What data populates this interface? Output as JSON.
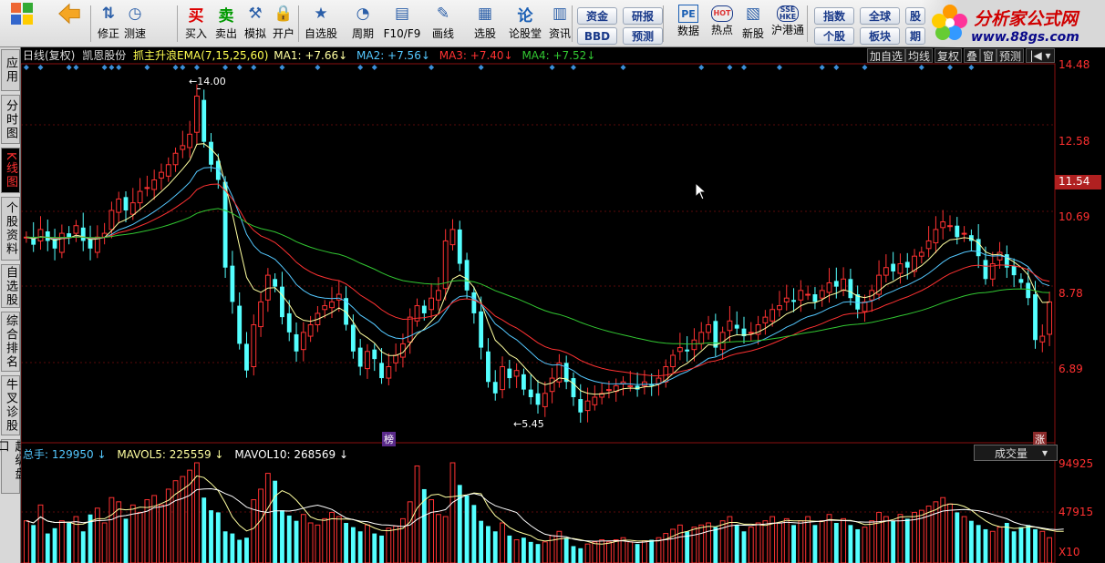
{
  "toolbar": {
    "buttons": [
      {
        "label": "修正",
        "icon": "up-down-arrow-icon"
      },
      {
        "label": "测速",
        "icon": "clock-icon"
      },
      {
        "label": "买入",
        "icon": "buy-icon",
        "glyph": "买"
      },
      {
        "label": "卖出",
        "icon": "sell-icon",
        "glyph": "卖"
      },
      {
        "label": "模拟",
        "icon": "hammer-icon"
      },
      {
        "label": "开户",
        "icon": "lock-icon"
      },
      {
        "label": "自选股",
        "icon": "star-list-icon"
      },
      {
        "label": "周期",
        "icon": "period-icon"
      },
      {
        "label": "F10/F9",
        "icon": "f10-icon"
      },
      {
        "label": "画线",
        "icon": "pen-icon"
      },
      {
        "label": "选股",
        "icon": "select-stock-icon"
      },
      {
        "label": "论股堂",
        "icon": "forum-icon",
        "glyph": "论"
      },
      {
        "label": "资讯",
        "icon": "news-icon"
      },
      {
        "label": "数据",
        "icon": "pe-icon",
        "glyph": "PE"
      },
      {
        "label": "热点",
        "icon": "hot-icon",
        "glyph": "HOT"
      },
      {
        "label": "新股",
        "icon": "new-stock-icon"
      },
      {
        "label": "沪港通",
        "icon": "sse-hke-icon",
        "glyph": "SSE HKE"
      }
    ],
    "pills": [
      "资金",
      "BBD",
      "研报",
      "预测",
      "指数",
      "个股",
      "全球",
      "板块",
      "股",
      "期"
    ],
    "logo_title": "分析家公式网",
    "logo_url": "www.88gs.com"
  },
  "left_tabs": [
    "应用",
    "分时图",
    "K线图",
    "个股资料",
    "自选股",
    "综合排名",
    "牛叉诊股",
    "超级盘口"
  ],
  "header": {
    "period": "日线(复权)",
    "stock": "凯恩股份",
    "indicator": "抓主升浪EMA(7,15,25,60)",
    "ma1": "MA1: +7.66",
    "ma2": "MA2: +7.56",
    "ma3": "MA3: +7.40",
    "ma4": "MA4: +7.52",
    "right_buttons": [
      "加自选",
      "均线",
      "复权",
      "叠",
      "窗",
      "预测"
    ]
  },
  "price_axis": [
    "14.48",
    "12.58",
    "11.54",
    "10.69",
    "8.78",
    "6.89"
  ],
  "volume_axis": [
    "94925",
    "47915",
    "X10"
  ],
  "annotations": {
    "high": "14.00",
    "low": "5.45",
    "bang": "榜",
    "zhang": "涨"
  },
  "volume_header": {
    "total": "总手: 129950",
    "mavol5": "MAVOL5: 225559",
    "mavol10": "MAVOL10: 268569",
    "selector": "成交量"
  },
  "colors": {
    "up": "#ff3232",
    "down": "#54ffff",
    "ma1": "#ffffa0",
    "ma2": "#54c8ff",
    "ma3": "#ff3232",
    "ma4": "#32c832",
    "marker": "#3b8fd9",
    "label_red": "#ff3030"
  },
  "chart_data": {
    "type": "candlestick",
    "y_range": [
      5.0,
      14.8
    ],
    "volume_range": [
      0,
      95000
    ],
    "close": [
      10.3,
      10.1,
      10.5,
      10.2,
      10.0,
      10.4,
      10.3,
      10.6,
      10.2,
      10.0,
      10.3,
      10.4,
      11.0,
      11.3,
      11.0,
      11.2,
      11.5,
      11.6,
      11.8,
      12.0,
      12.2,
      12.5,
      12.7,
      13.0,
      14.0,
      12.8,
      12.2,
      11.8,
      9.5,
      8.6,
      7.5,
      6.8,
      8.0,
      8.6,
      9.3,
      9.0,
      8.2,
      7.8,
      7.3,
      7.8,
      8.0,
      8.3,
      8.5,
      8.6,
      8.8,
      8.0,
      7.3,
      6.9,
      7.3,
      7.1,
      6.6,
      6.9,
      7.2,
      7.5,
      8.2,
      8.5,
      8.3,
      8.7,
      8.9,
      10.2,
      10.5,
      9.6,
      8.9,
      8.3,
      7.4,
      6.5,
      6.2,
      6.9,
      6.6,
      6.8,
      6.3,
      6.1,
      5.9,
      6.2,
      6.6,
      7.0,
      6.5,
      6.1,
      5.7,
      6.0,
      6.1,
      6.2,
      6.3,
      6.4,
      6.5,
      6.4,
      6.3,
      6.5,
      6.4,
      6.6,
      6.9,
      7.2,
      7.4,
      7.3,
      7.6,
      7.8,
      8.0,
      7.4,
      7.8,
      8.1,
      7.9,
      7.7,
      7.8,
      8.0,
      8.2,
      8.4,
      8.5,
      8.7,
      8.6,
      8.9,
      8.8,
      8.6,
      8.9,
      9.1,
      9.0,
      9.2,
      8.7,
      8.4,
      8.6,
      8.9,
      9.3,
      9.5,
      9.4,
      9.6,
      9.5,
      9.8,
      9.9,
      10.2,
      10.5,
      10.7,
      10.6,
      10.3,
      10.4,
      10.2,
      9.8,
      9.2,
      9.6,
      9.9,
      9.5,
      9.3,
      9.1,
      8.7,
      7.6,
      7.7,
      8.6
    ],
    "volume": [
      40,
      36,
      55,
      28,
      33,
      40,
      38,
      44,
      30,
      46,
      52,
      38,
      62,
      58,
      42,
      55,
      48,
      60,
      64,
      55,
      70,
      78,
      82,
      88,
      95,
      62,
      50,
      48,
      30,
      28,
      22,
      24,
      60,
      70,
      85,
      78,
      50,
      45,
      40,
      46,
      38,
      36,
      42,
      48,
      44,
      38,
      34,
      30,
      36,
      28,
      26,
      33,
      35,
      42,
      58,
      92,
      70,
      60,
      46,
      44,
      95,
      74,
      64,
      55,
      40,
      35,
      30,
      38,
      26,
      22,
      24,
      20,
      18,
      20,
      26,
      30,
      24,
      16,
      14,
      18,
      20,
      22,
      20,
      22,
      24,
      20,
      18,
      21,
      22,
      24,
      28,
      32,
      36,
      30,
      34,
      36,
      38,
      34,
      40,
      44,
      36,
      30,
      34,
      38,
      40,
      44,
      38,
      42,
      36,
      40,
      44,
      36,
      40,
      46,
      38,
      42,
      36,
      32,
      34,
      40,
      48,
      44,
      40,
      46,
      42,
      48,
      50,
      54,
      58,
      62,
      56,
      48,
      44,
      40,
      36,
      32,
      30,
      34,
      38,
      30,
      34,
      36,
      32,
      30,
      24,
      28,
      36
    ],
    "high_label": 14.0,
    "low_label": 5.45
  }
}
